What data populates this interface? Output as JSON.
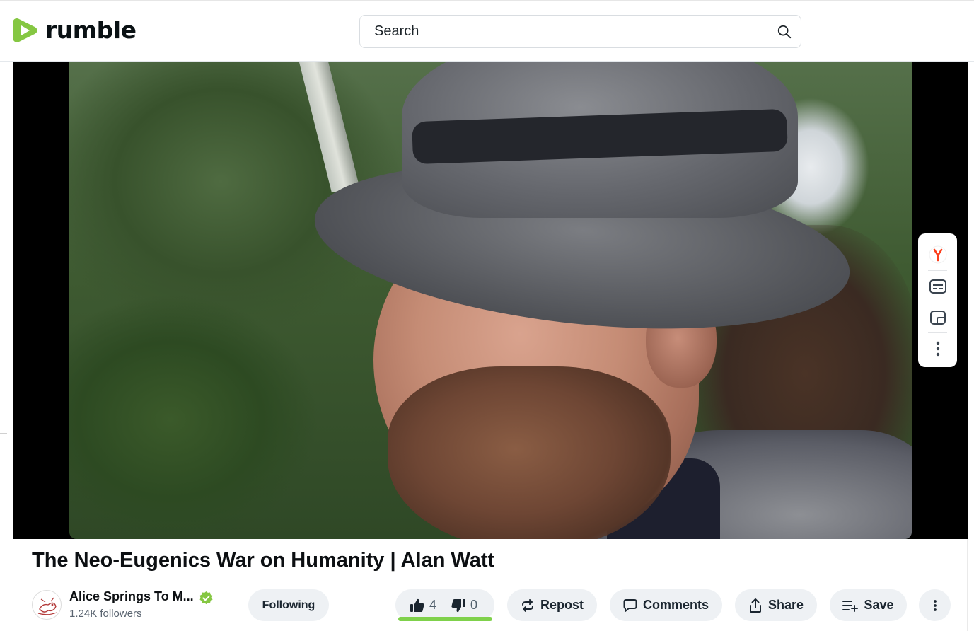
{
  "header": {
    "logo_text": "rumble",
    "search_placeholder": "Search"
  },
  "video": {
    "title": "The Neo-Eugenics War on Humanity | Alan Watt"
  },
  "channel": {
    "name": "Alice Springs To M...",
    "followers": "1.24K followers",
    "follow_label": "Following"
  },
  "actions": {
    "likes": "4",
    "dislikes": "0",
    "repost_label": "Repost",
    "comments_label": "Comments",
    "share_label": "Share",
    "save_label": "Save"
  },
  "colors": {
    "brand_green": "#85c742",
    "vote_bar": "#7fd14b",
    "pill_bg": "#eef1f4"
  },
  "icons": [
    "search-icon",
    "yandex-icon",
    "captions-icon",
    "pip-icon",
    "more-vertical-icon",
    "verified-icon",
    "thumbs-up-icon",
    "thumbs-down-icon",
    "repost-icon",
    "comment-icon",
    "share-icon",
    "save-playlist-icon"
  ]
}
